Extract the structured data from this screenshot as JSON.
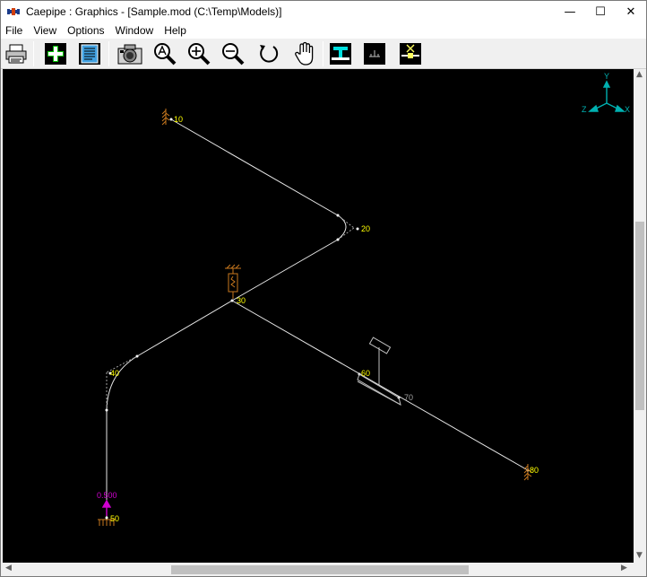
{
  "window": {
    "title": "Caepipe : Graphics -  [Sample.mod (C:\\Temp\\Models)]",
    "controls": {
      "minimize": "—",
      "maximize": "☐",
      "close": "✕"
    }
  },
  "menu": {
    "items": [
      "File",
      "View",
      "Options",
      "Window",
      "Help"
    ]
  },
  "toolbar": {
    "buttons": [
      "print",
      "add-element",
      "list",
      "camera",
      "zoom-auto",
      "zoom-in",
      "zoom-out",
      "rotate",
      "pan",
      "support-view",
      "model-view",
      "ground-view"
    ]
  },
  "model": {
    "nodes": [
      {
        "id": "10",
        "label": "10"
      },
      {
        "id": "20",
        "label": "20"
      },
      {
        "id": "30",
        "label": "30"
      },
      {
        "id": "40",
        "label": "40"
      },
      {
        "id": "50",
        "label": "50"
      },
      {
        "id": "60",
        "label": "60"
      },
      {
        "id": "70",
        "label": "70"
      },
      {
        "id": "80",
        "label": "80"
      }
    ],
    "load_label": "0.500",
    "axes": {
      "y": "Y",
      "x": "X",
      "z": "Z"
    }
  },
  "colors": {
    "pipe": "#e8e8e8",
    "node_label": "#ffff00",
    "support": "#c8781e",
    "load": "#d000d0",
    "axes": "#00b0b0",
    "background": "#000000"
  }
}
